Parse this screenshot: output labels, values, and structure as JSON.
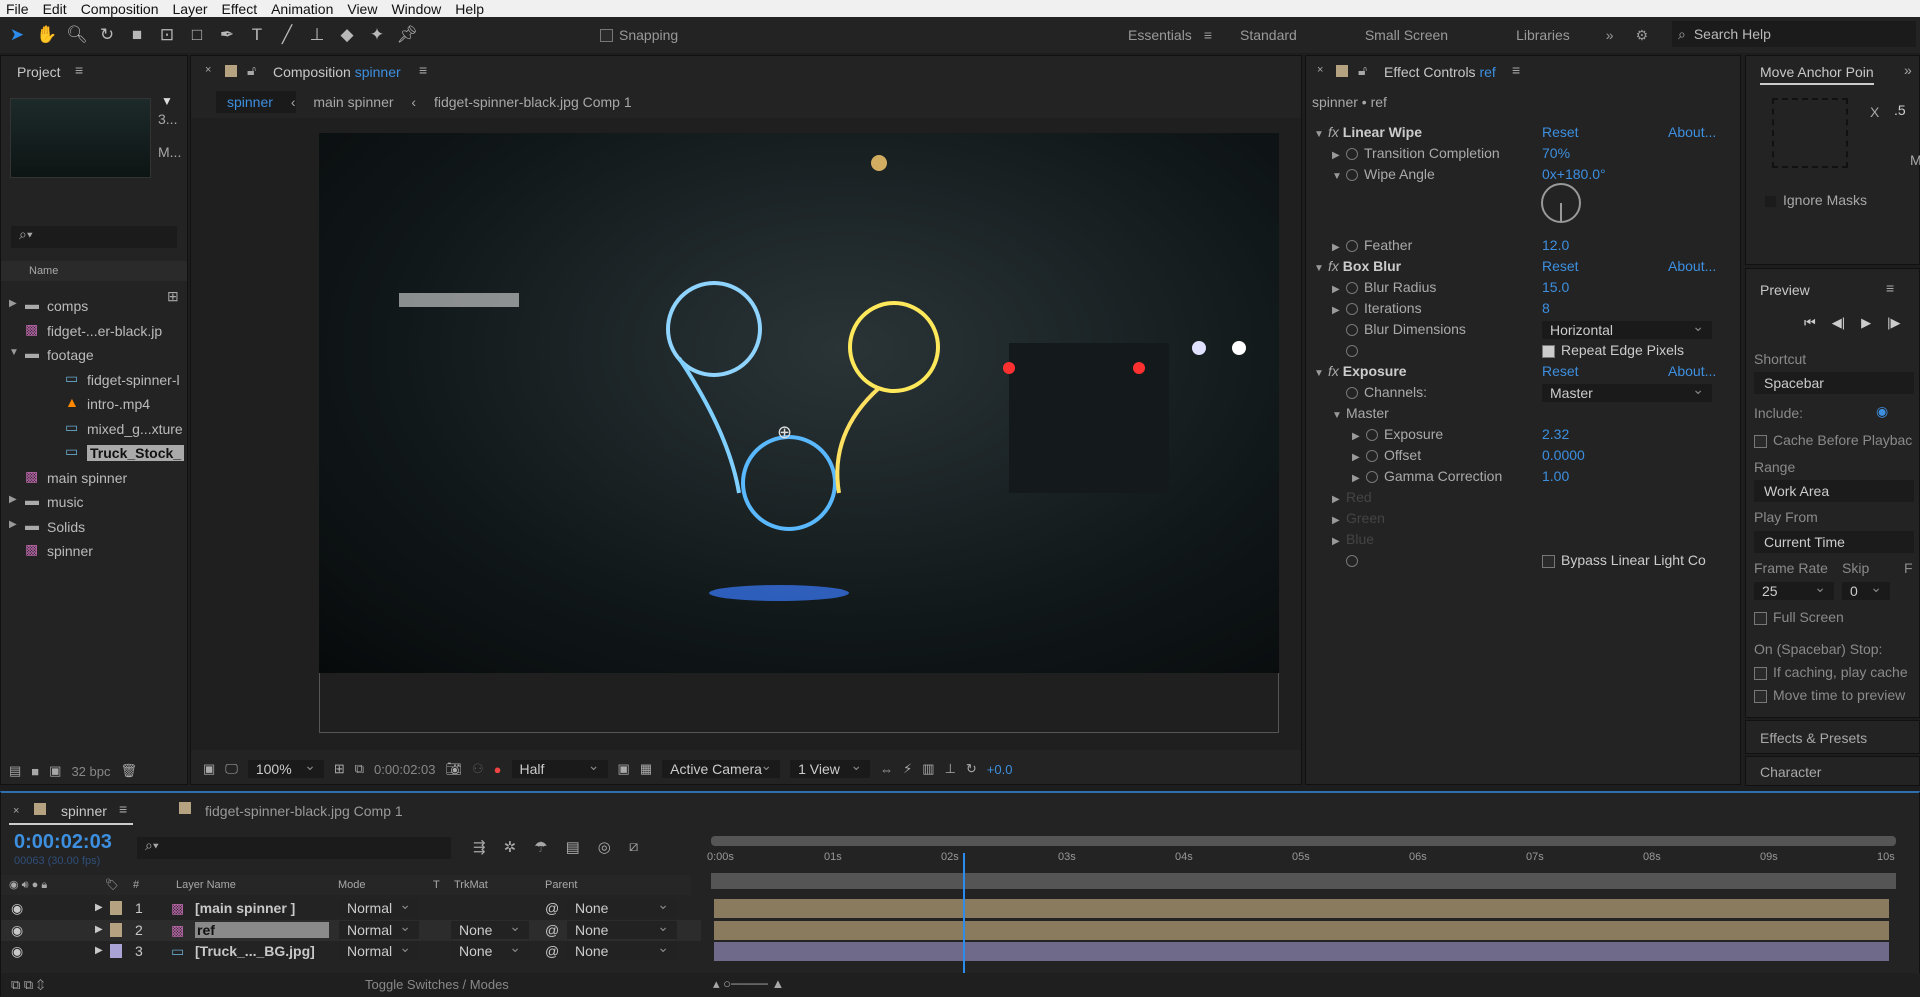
{
  "menu": [
    "File",
    "Edit",
    "Composition",
    "Layer",
    "Effect",
    "Animation",
    "View",
    "Window",
    "Help"
  ],
  "toolbar": {
    "snapping": "Snapping",
    "workspaces": [
      "Essentials",
      "Standard",
      "Small Screen",
      "Libraries"
    ],
    "active_workspace": "Essentials",
    "search_placeholder": "Search Help"
  },
  "project": {
    "title": "Project",
    "thumb_info": [
      "3...",
      "M..."
    ],
    "column_name": "Name",
    "items": [
      {
        "name": "comps",
        "type": "folder",
        "level": 0,
        "arrow": "▶"
      },
      {
        "name": "fidget-...er-black.jp",
        "type": "comp",
        "level": 0
      },
      {
        "name": "footage",
        "type": "folder",
        "level": 0,
        "arrow": "▼"
      },
      {
        "name": "fidget-spinner-l",
        "type": "image",
        "level": 1
      },
      {
        "name": "intro-.mp4",
        "type": "video",
        "level": 1
      },
      {
        "name": "mixed_g...xture",
        "type": "image",
        "level": 1
      },
      {
        "name": "Truck_Stock_",
        "type": "image",
        "level": 1,
        "selected": true
      },
      {
        "name": "main spinner",
        "type": "comp",
        "level": 0
      },
      {
        "name": "music",
        "type": "folder",
        "level": 0,
        "arrow": "▶"
      },
      {
        "name": "Solids",
        "type": "folder",
        "level": 0,
        "arrow": "▶"
      },
      {
        "name": "spinner",
        "type": "comp",
        "level": 0
      }
    ],
    "bpc": "32 bpc"
  },
  "composition": {
    "tab_label": "Composition",
    "tab_comp": "spinner",
    "breadcrumbs": [
      "spinner",
      "main spinner",
      "fidget-spinner-black.jpg Comp 1"
    ],
    "viewer_toolbar": {
      "zoom": "100%",
      "timecode": "0:00:02:03",
      "resolution": "Half",
      "camera": "Active Camera",
      "views": "1 View",
      "exposure": "+0.0"
    }
  },
  "effect_controls": {
    "tab_label": "Effect Controls",
    "layer": "ref",
    "path": "spinner • ref",
    "reset": "Reset",
    "about": "About...",
    "effects": [
      {
        "name": "Linear Wipe",
        "props": [
          {
            "label": "Transition Completion",
            "value": "70%"
          },
          {
            "label": "Wipe Angle",
            "value": "0x+180.0°"
          },
          {
            "label": "Feather",
            "value": "12.0"
          }
        ]
      },
      {
        "name": "Box Blur",
        "props": [
          {
            "label": "Blur Radius",
            "value": "15.0"
          },
          {
            "label": "Iterations",
            "value": "8"
          },
          {
            "label": "Blur Dimensions",
            "value": "Horizontal"
          },
          {
            "label": "Repeat Edge Pixels",
            "checked": true
          }
        ]
      },
      {
        "name": "Exposure",
        "props": [
          {
            "label": "Channels:",
            "value": "Master"
          },
          {
            "label": "Master"
          },
          {
            "label": "Exposure",
            "value": "2.32"
          },
          {
            "label": "Offset",
            "value": "0.0000"
          },
          {
            "label": "Gamma Correction",
            "value": "1.00"
          },
          {
            "label": "Red"
          },
          {
            "label": "Green"
          },
          {
            "label": "Blue"
          },
          {
            "label": "Bypass Linear Light Co",
            "checked": false
          }
        ]
      }
    ]
  },
  "right": {
    "anchor_title": "Move Anchor Poin",
    "x_label": "X",
    "x_value": ".5",
    "m_label": "M",
    "ignore_masks": "Ignore Masks",
    "preview": {
      "title": "Preview",
      "shortcut_label": "Shortcut",
      "shortcut": "Spacebar",
      "include": "Include:",
      "cache": "Cache Before Playbac",
      "range_label": "Range",
      "range": "Work Area",
      "play_from_label": "Play From",
      "play_from": "Current Time",
      "frame_rate_label": "Frame Rate",
      "frame_rate": "25",
      "skip_label": "Skip",
      "skip": "0",
      "f_label": "F",
      "full_screen": "Full Screen",
      "stop_label": "On (Spacebar) Stop:",
      "stop1": "If caching, play cache",
      "stop2": "Move time to preview"
    },
    "effects_presets": "Effects & Presets",
    "character": "Character"
  },
  "timeline": {
    "tabs": [
      "spinner",
      "fidget-spinner-black.jpg Comp 1"
    ],
    "timecode": "0:00:02:03",
    "frames": "00063 (30.00 fps)",
    "columns": {
      "num": "#",
      "name": "Layer Name",
      "mode": "Mode",
      "t": "T",
      "trkmat": "TrkMat",
      "parent": "Parent"
    },
    "layers": [
      {
        "num": "1",
        "name": "[main spinner ]",
        "mode": "Normal",
        "trkmat": "",
        "parent": "None",
        "color": "#b4a280"
      },
      {
        "num": "2",
        "name": "ref",
        "mode": "Normal",
        "trkmat": "None",
        "parent": "None",
        "color": "#b4a280"
      },
      {
        "num": "3",
        "name": "[Truck_..._BG.jpg]",
        "mode": "Normal",
        "trkmat": "None",
        "parent": "None",
        "color": "#aaa3d6"
      }
    ],
    "ruler": [
      "0:00s",
      "01s",
      "02s",
      "03s",
      "04s",
      "05s",
      "06s",
      "07s",
      "08s",
      "09s",
      "10s"
    ],
    "playhead_seconds": 2.1,
    "toggle": "Toggle Switches / Modes"
  },
  "colors": {
    "accent": "#3d8fe0",
    "panel": "#232323"
  }
}
